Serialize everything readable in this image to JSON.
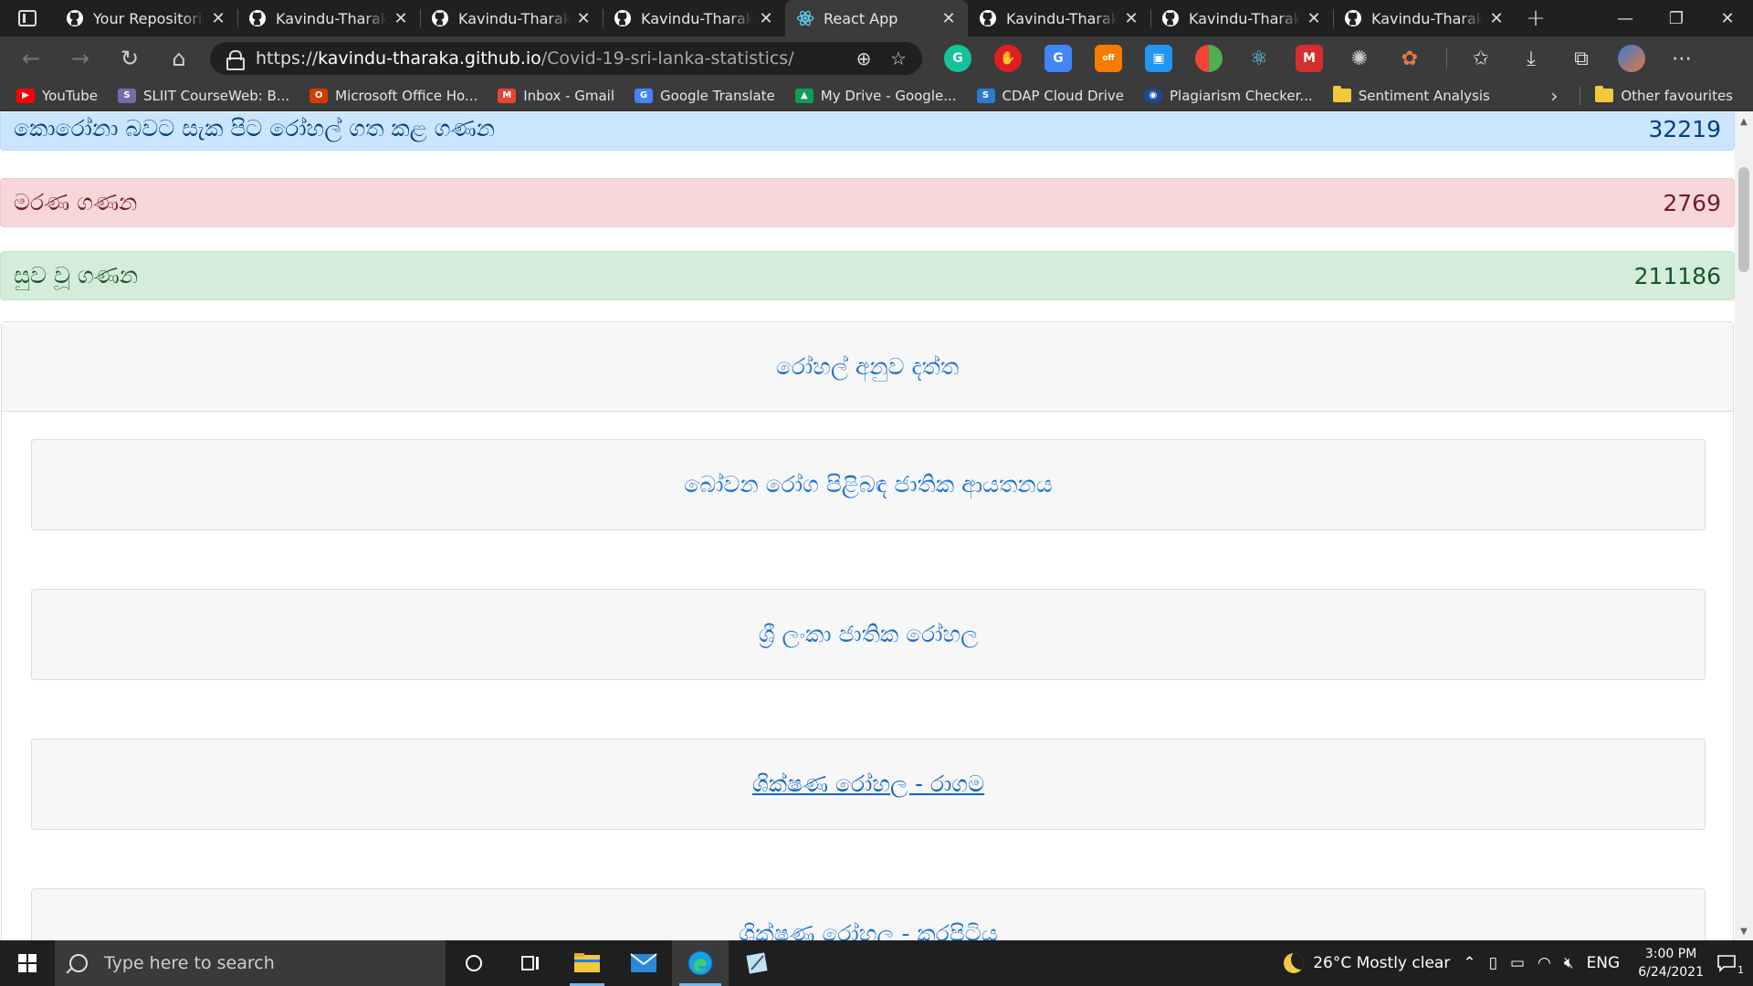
{
  "browser": {
    "tabs": [
      {
        "title": "Your Repositories",
        "icon": "github-icon",
        "active": false
      },
      {
        "title": "Kavindu-Tharaka/",
        "icon": "github-icon",
        "active": false
      },
      {
        "title": "Kavindu-Tharaka/",
        "icon": "github-icon",
        "active": false
      },
      {
        "title": "Kavindu-Tharaka/",
        "icon": "github-icon",
        "active": false
      },
      {
        "title": "React App",
        "icon": "react-icon",
        "active": true
      },
      {
        "title": "Kavindu-Tharaka/",
        "icon": "github-icon",
        "active": false
      },
      {
        "title": "Kavindu-Tharaka/",
        "icon": "github-icon",
        "active": false
      },
      {
        "title": "Kavindu-Tharaka/",
        "icon": "github-icon",
        "active": false
      }
    ],
    "url_scheme": "https://",
    "url_host": "kavindu-tharaka.github.io",
    "url_path": "/Covid-19-sri-lanka-statistics/",
    "favorites": [
      {
        "label": "YouTube",
        "icon": "youtube-icon",
        "color": "#ff0000"
      },
      {
        "label": "SLIIT CourseWeb: B...",
        "icon": "sliit-icon",
        "color": "#7a6aa8"
      },
      {
        "label": "Microsoft Office Ho...",
        "icon": "office-icon",
        "color": "#d83b01"
      },
      {
        "label": "Inbox - Gmail",
        "icon": "gmail-icon",
        "color": "#ea4335"
      },
      {
        "label": "Google Translate",
        "icon": "translate-icon",
        "color": "#4285f4"
      },
      {
        "label": "My Drive - Google...",
        "icon": "drive-icon",
        "color": "#0f9d58"
      },
      {
        "label": "CDAP Cloud Drive",
        "icon": "cloud-icon",
        "color": "#2b7bd6"
      },
      {
        "label": "Plagiarism Checker...",
        "icon": "plagiarism-icon",
        "color": "#1a4c9c"
      },
      {
        "label": "Sentiment Analysis",
        "icon": "folder-icon",
        "color": "#f0c93c"
      }
    ],
    "other_favourites": "Other favourites"
  },
  "page": {
    "stats": {
      "hospitalized_label": "කොරෝනා බවට සැක පිට රෝහල් ගත කළ ගණන",
      "hospitalized_value": "32219",
      "deaths_label": "මරණ ගණන",
      "deaths_value": "2769",
      "recovered_label": "සුව වූ ගණන",
      "recovered_value": "211186"
    },
    "hospital_card": {
      "header": "රෝහල් අනුව දත්ත",
      "hospitals": [
        {
          "name": "බෝවන රෝග පිළිබඳ ජාතික ආයතනය",
          "link": false
        },
        {
          "name": "ශ්‍රී ලංකා ජාතික රෝහල",
          "link": false
        },
        {
          "name": "ශික්ෂණ රෝහල - රාගම",
          "link": true
        },
        {
          "name": "ශික්ෂණ රෝහල - කරපිටිය",
          "link": false
        }
      ]
    }
  },
  "taskbar": {
    "search_placeholder": "Type here to search",
    "weather": "26°C  Mostly clear",
    "language": "ENG",
    "time": "3:00 PM",
    "date": "6/24/2021",
    "notification_count": "1"
  },
  "colors": {
    "info_bg": "#cce5ff",
    "danger_bg": "#f8d7da",
    "success_bg": "#d4edda",
    "link_blue": "#1a6fd0"
  }
}
